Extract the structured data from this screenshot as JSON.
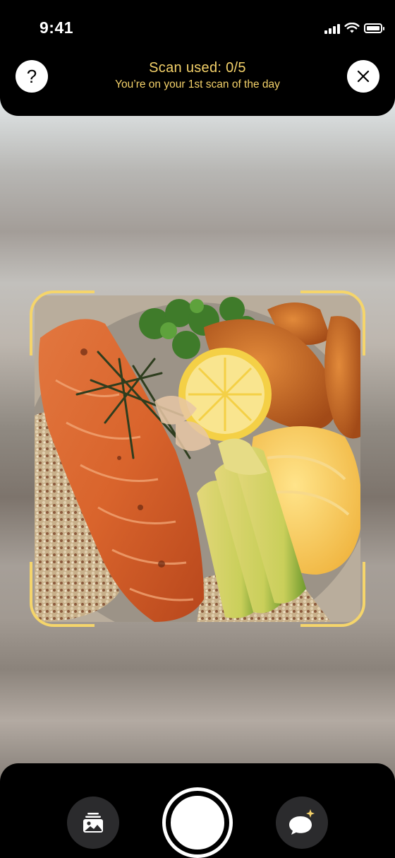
{
  "status_bar": {
    "time": "9:41",
    "icons": [
      "cellular-signal-icon",
      "wifi-icon",
      "battery-icon"
    ]
  },
  "header": {
    "help_label": "?",
    "scan_title": "Scan used: 0/5",
    "scan_subtitle": "You’re on your 1st scan of the day",
    "close_icon": "close-icon"
  },
  "viewfinder": {
    "image_subject": "salmon bowl with avocado, lemon, sweet potato and quinoa",
    "corner_color": "#f5d56b"
  },
  "bottom_bar": {
    "gallery_icon": "photo-gallery-icon",
    "shutter": "shutter-button",
    "chat_icon": "ai-chat-sparkle-icon"
  },
  "colors": {
    "accent_yellow": "#f5d26a",
    "bar_background": "#000000",
    "side_button": "#2b2b2d"
  }
}
